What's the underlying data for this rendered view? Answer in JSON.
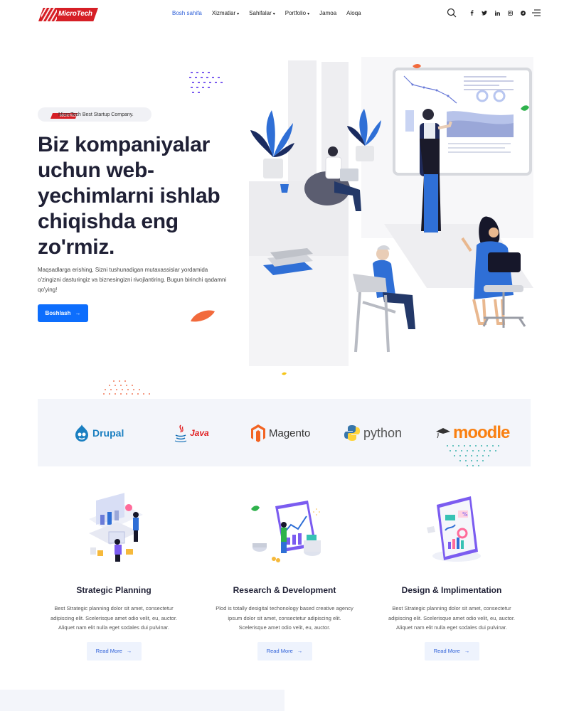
{
  "header": {
    "logo_text": "MicroTech",
    "nav": [
      {
        "label": "Bosh sahifa",
        "active": true,
        "dropdown": false
      },
      {
        "label": "Xizmatlar",
        "active": false,
        "dropdown": true
      },
      {
        "label": "Sahifalar",
        "active": false,
        "dropdown": true
      },
      {
        "label": "Portfolio",
        "active": false,
        "dropdown": true
      },
      {
        "label": "Jamoa",
        "active": false,
        "dropdown": false
      },
      {
        "label": "Aloqa",
        "active": false,
        "dropdown": false
      }
    ],
    "social": [
      "f",
      "t",
      "in",
      "ig",
      "tg"
    ],
    "icons": [
      "search-icon",
      "facebook-icon",
      "twitter-icon",
      "linkedin-icon",
      "instagram-icon",
      "telegram-icon",
      "menu-icon"
    ]
  },
  "hero": {
    "badge_logo": "MicroTech",
    "badge_text": "MicroTech Best Startup Company.",
    "title": "Biz kompaniyalar uchun web-yechimlarni ishlab chiqishda eng zo'rmiz.",
    "description": "Maqsadlarga erishing, Sizni tushunadigan mutaxassislar yordamida o'zingizni dasturingiz va biznesingizni rivojlantiring. Bugun birinchi qadamni qo'ying!",
    "button_label": "Boshlash"
  },
  "brands": {
    "drupal": "Drupal",
    "java": "Java",
    "magento": "Magento",
    "python": "python",
    "moodle": "moodle"
  },
  "features": [
    {
      "title": "Strategic Planning",
      "text": "Best Strategic planning dolor sit amet, consectetur adipiscing elit. Scelerisque amet odio velit, eu, auctor. Aliquet nam elit nulla eget sodales dui pulvinar.",
      "button": "Read More"
    },
    {
      "title": "Research & Development",
      "text": "Plod is totally desigital techonology based creative agency ipsum dolor sit amet, consectetur adipiscing elit. Scelerisque amet odio velit, eu, auctor.",
      "button": "Read More"
    },
    {
      "title": "Design & Implimentation",
      "text": "Best Strategic planning dolor sit amet, consectetur adipiscing elit. Scelerisque amet odio velit, eu, auctor. Aliquet nam elit nulla eget sodales dui pulvinar.",
      "button": "Read More"
    }
  ],
  "colors": {
    "primary": "#0d6efd",
    "brand_red": "#d61f26",
    "nav_active": "#2d5fd8",
    "band_bg": "#f3f5fa"
  }
}
